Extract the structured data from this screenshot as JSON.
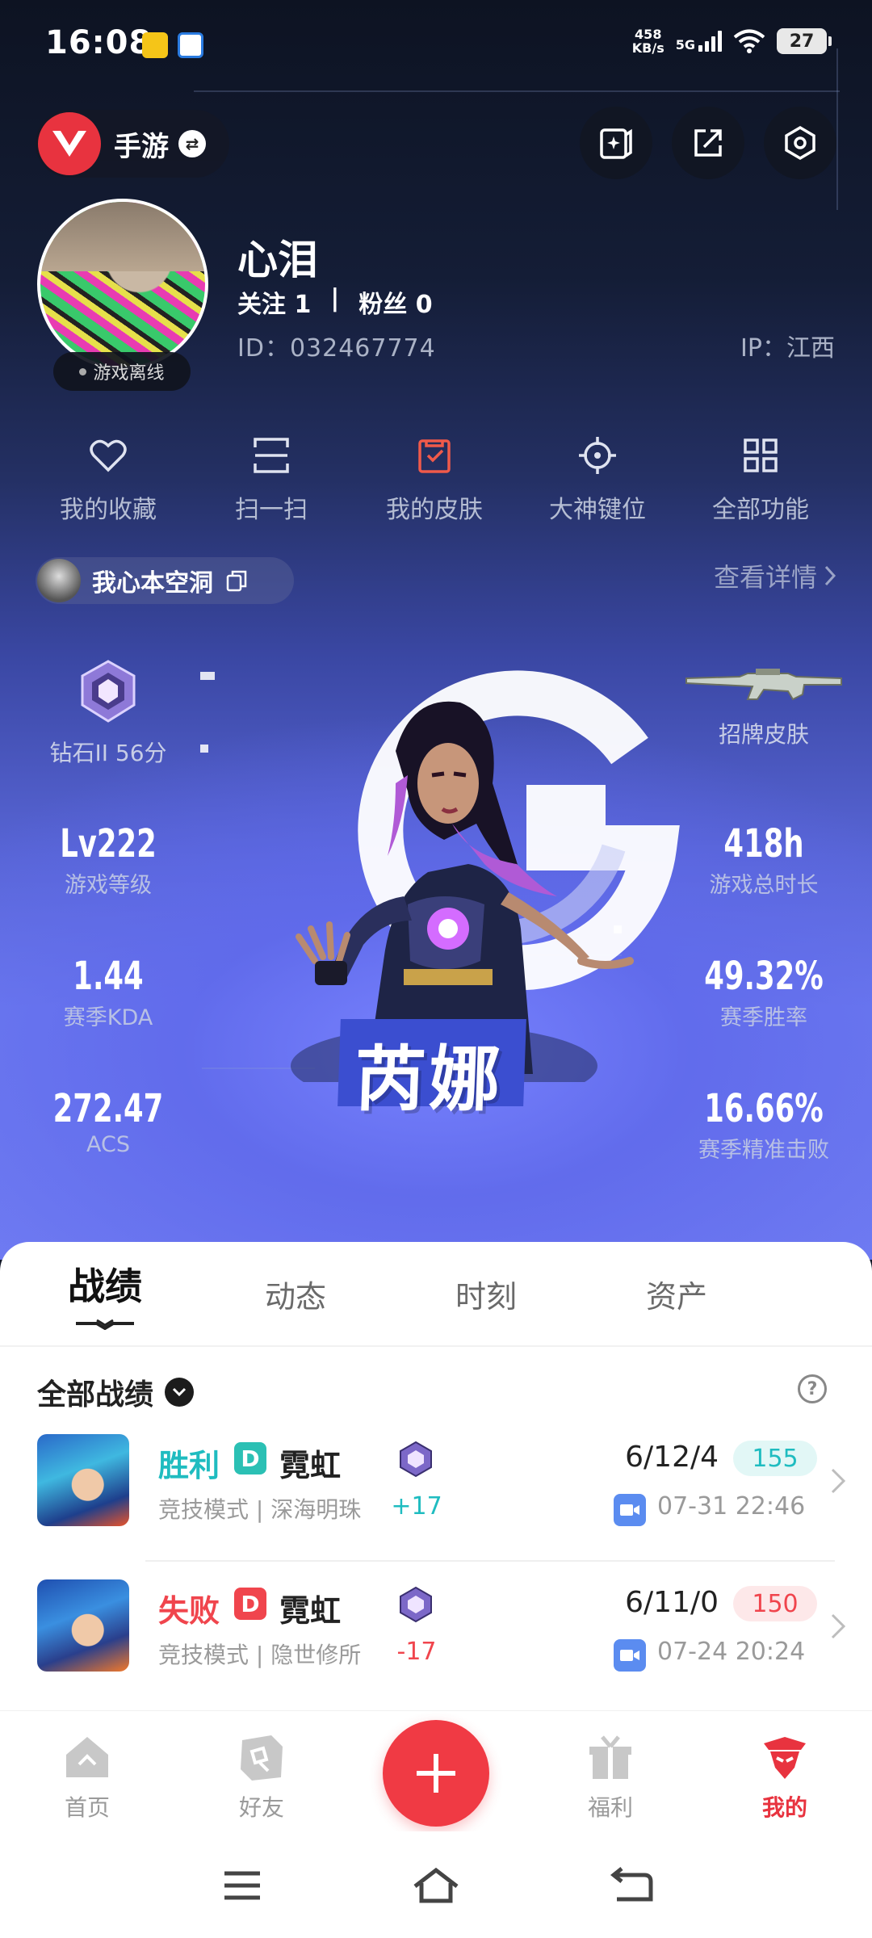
{
  "status_bar": {
    "time": "16:08",
    "net_speed_value": "458",
    "net_speed_unit": "KB/s",
    "network": "5G",
    "battery": "27"
  },
  "header": {
    "game_name": "手游",
    "game_switch_icon": "swap-icon",
    "actions": [
      "edit-card-icon",
      "share-icon",
      "settings-icon"
    ]
  },
  "profile": {
    "nickname": "心泪",
    "following_label": "关注",
    "following_count": "1",
    "separator": "|",
    "followers_label": "粉丝",
    "followers_count": "0",
    "id_text": "ID：032467774",
    "ip_text": "IP：江西",
    "status": "游戏离线"
  },
  "quick_functions": [
    {
      "label": "我的收藏",
      "icon": "heart-icon"
    },
    {
      "label": "扫一扫",
      "icon": "scan-icon"
    },
    {
      "label": "我的皮肤",
      "icon": "skin-icon"
    },
    {
      "label": "大神键位",
      "icon": "crosshair-icon"
    },
    {
      "label": "全部功能",
      "icon": "grid-icon"
    }
  ],
  "game_card": {
    "role_name": "我心本空洞",
    "detail_link": "查看详情",
    "rank_label": "钻石II 56分",
    "skin_label": "招牌皮肤",
    "agent_name": "芮娜",
    "left_stats": [
      {
        "value": "Lv222",
        "label": "游戏等级"
      },
      {
        "value": "1.44",
        "label": "赛季KDA"
      },
      {
        "value": "272.47",
        "label": "ACS"
      }
    ],
    "right_stats": [
      {
        "value": "418h",
        "label": "游戏总时长"
      },
      {
        "value": "49.32%",
        "label": "赛季胜率"
      },
      {
        "value": "16.66%",
        "label": "赛季精准击败"
      }
    ],
    "colors": {
      "accent_blue": "#3b4ed0"
    }
  },
  "tabs": [
    {
      "label": "战绩",
      "active": true
    },
    {
      "label": "动态",
      "active": false
    },
    {
      "label": "时刻",
      "active": false
    },
    {
      "label": "资产",
      "active": false
    }
  ],
  "records": {
    "filter_label": "全部战绩",
    "matches": [
      {
        "result": "胜利",
        "tag": "D",
        "agent": "霓虹",
        "mode": "竞技模式 | 深海明珠",
        "delta": "+17",
        "kda": "6/12/4",
        "score": "155",
        "date": "07-31 22:46",
        "outcome": "win"
      },
      {
        "result": "失败",
        "tag": "D",
        "agent": "霓虹",
        "mode": "竞技模式 | 隐世修所",
        "delta": "-17",
        "kda": "6/11/0",
        "score": "150",
        "date": "07-24 20:24",
        "outcome": "lose"
      }
    ]
  },
  "bottom_nav": [
    {
      "label": "首页",
      "icon": "home-icon",
      "active": false
    },
    {
      "label": "好友",
      "icon": "friends-icon",
      "active": false
    },
    {
      "label": "福利",
      "icon": "gift-icon",
      "active": false
    },
    {
      "label": "我的",
      "icon": "profile-icon",
      "active": true
    }
  ],
  "colors": {
    "brand_red": "#f03a44",
    "win": "#1fbcc0",
    "lose": "#f0454d"
  }
}
